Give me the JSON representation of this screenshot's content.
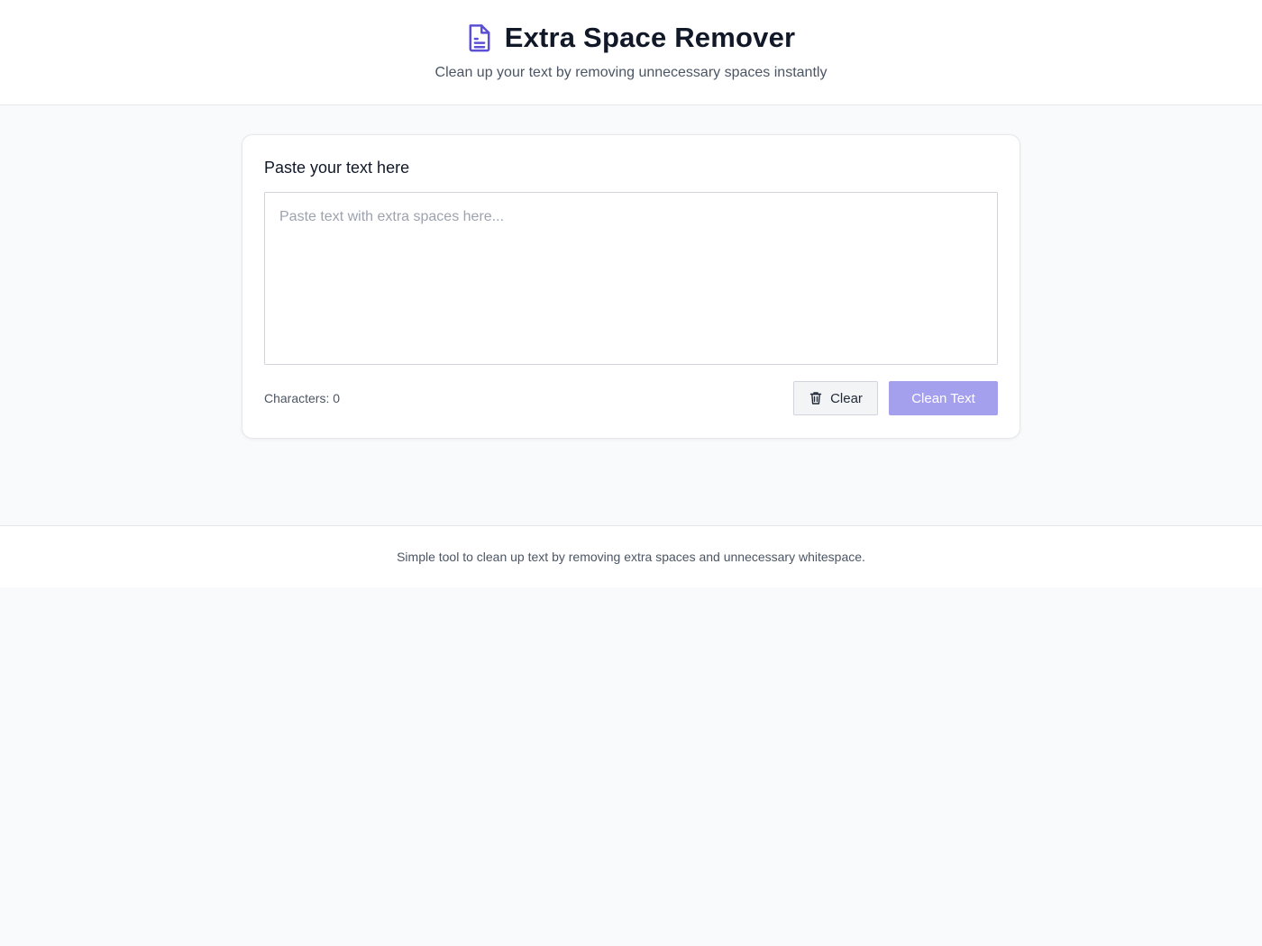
{
  "header": {
    "icon": "document-icon",
    "title": "Extra Space Remover",
    "subtitle": "Clean up your text by removing unnecessary spaces instantly"
  },
  "editor": {
    "label": "Paste your text here",
    "placeholder": "Paste text with extra spaces here...",
    "value": "",
    "char_count": "Characters: 0"
  },
  "actions": {
    "clear_icon": "trash-icon",
    "clear_label": "Clear",
    "clean_label": "Clean Text"
  },
  "footer": {
    "text": "Simple tool to clean up text by removing extra spaces and unnecessary whitespace."
  },
  "colors": {
    "accent": "#5b4fd6",
    "accent_disabled": "#a5a0ee"
  }
}
